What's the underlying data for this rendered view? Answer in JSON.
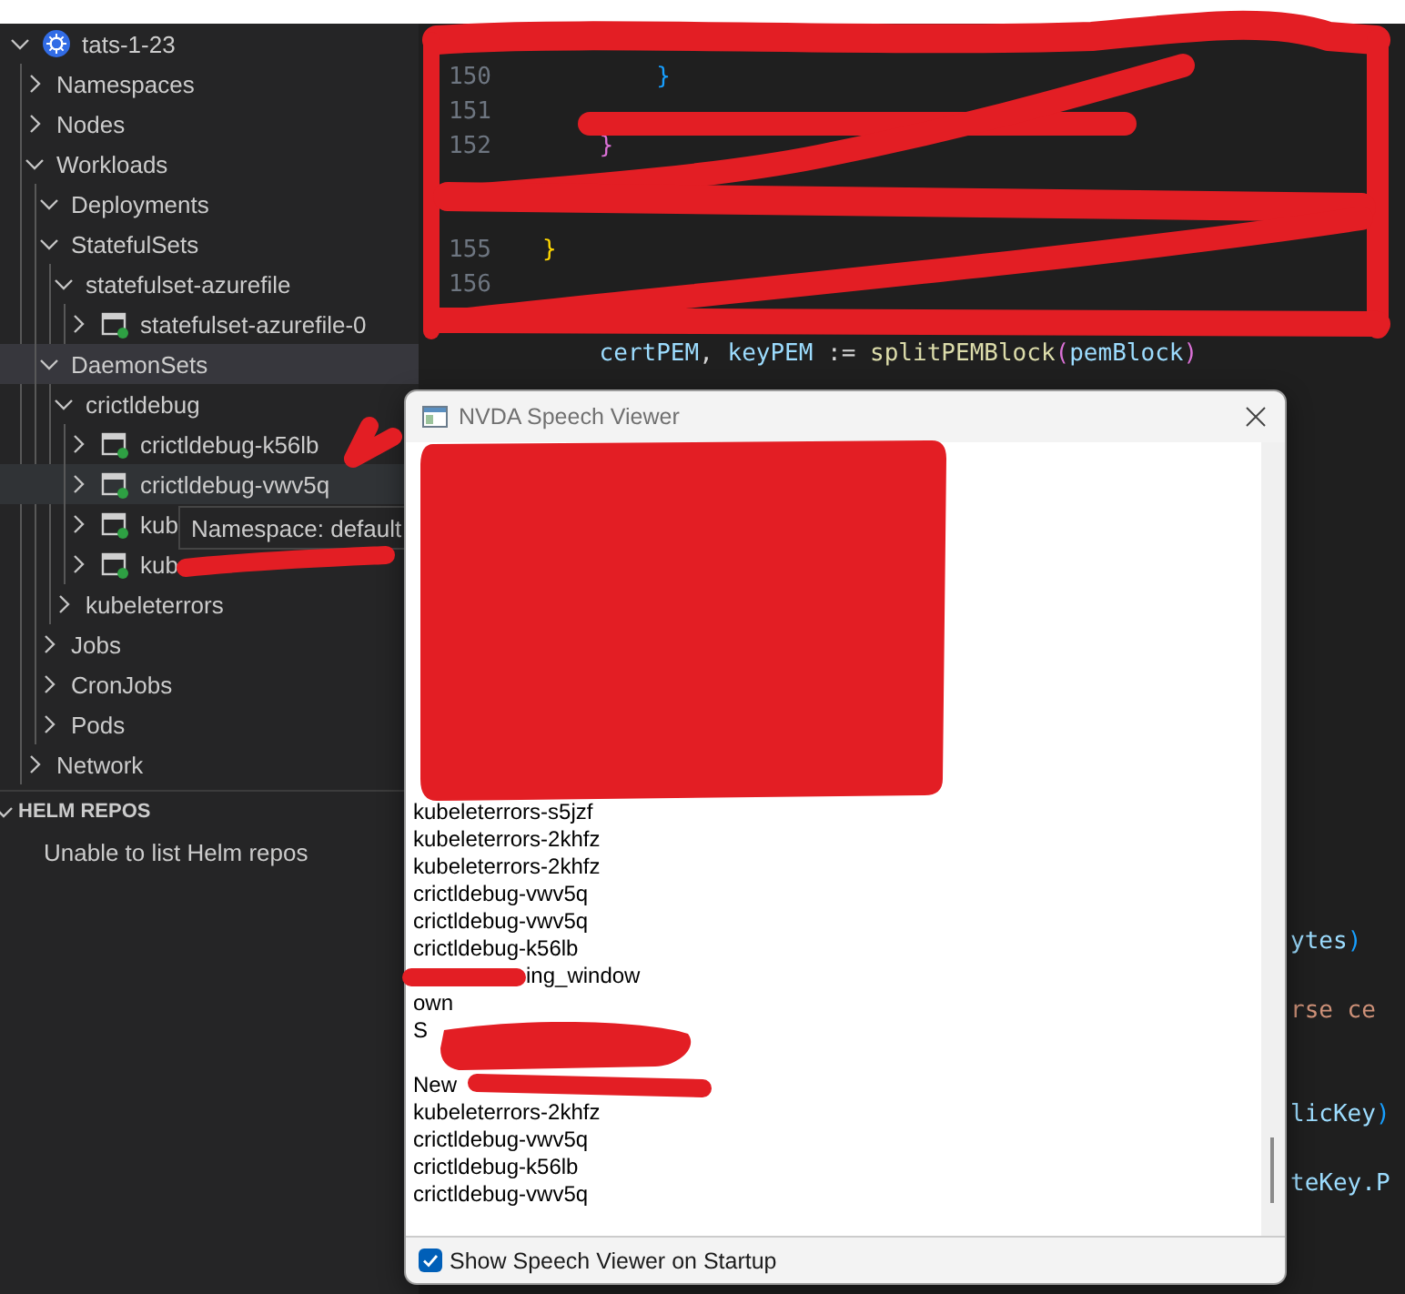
{
  "explorer": {
    "tree": [
      {
        "label": "tats-1-23",
        "kind": "cluster",
        "expanded": true,
        "selected": false,
        "hovered": false,
        "children": [
          {
            "label": "Namespaces",
            "expanded": false,
            "selected": false,
            "hovered": false
          },
          {
            "label": "Nodes",
            "expanded": false,
            "selected": false,
            "hovered": false
          },
          {
            "label": "Workloads",
            "expanded": true,
            "selected": false,
            "hovered": false,
            "children": [
              {
                "label": "Deployments",
                "expanded": true,
                "selected": false,
                "hovered": false
              },
              {
                "label": "StatefulSets",
                "expanded": true,
                "selected": false,
                "hovered": false,
                "children": [
                  {
                    "label": "statefulset-azurefile",
                    "expanded": true,
                    "selected": false,
                    "hovered": false,
                    "children": [
                      {
                        "label": "statefulset-azurefile-0",
                        "kind": "pod",
                        "expanded": false,
                        "selected": false,
                        "hovered": false
                      }
                    ]
                  }
                ]
              },
              {
                "label": "DaemonSets",
                "expanded": true,
                "selected": true,
                "hovered": false,
                "children": [
                  {
                    "label": "crictldebug",
                    "expanded": true,
                    "selected": false,
                    "hovered": false,
                    "children": [
                      {
                        "label": "crictldebug-k56lb",
                        "kind": "pod",
                        "expanded": false,
                        "selected": false,
                        "hovered": false
                      },
                      {
                        "label": "crictldebug-vwv5q",
                        "kind": "pod",
                        "expanded": false,
                        "selected": false,
                        "hovered": true
                      },
                      {
                        "label": "kub",
                        "kind": "pod",
                        "expanded": false,
                        "selected": false,
                        "hovered": false
                      },
                      {
                        "label": "kub",
                        "kind": "pod",
                        "expanded": false,
                        "selected": false,
                        "hovered": false
                      }
                    ]
                  },
                  {
                    "label": "kubeleterrors",
                    "expanded": false,
                    "selected": false,
                    "hovered": false
                  }
                ]
              },
              {
                "label": "Jobs",
                "expanded": false,
                "selected": false,
                "hovered": false
              },
              {
                "label": "CronJobs",
                "expanded": false,
                "selected": false,
                "hovered": false
              },
              {
                "label": "Pods",
                "expanded": false,
                "selected": false,
                "hovered": false
              }
            ]
          },
          {
            "label": "Network",
            "expanded": false,
            "selected": false,
            "hovered": false
          }
        ]
      }
    ],
    "tooltip": {
      "text": "Namespace: default"
    },
    "helm_repos": {
      "title": "HELM REPOS",
      "expanded": true,
      "message": "Unable to list Helm repos"
    }
  },
  "editor": {
    "lines": [
      {
        "number": "150",
        "tokens": [
          {
            "text": "}",
            "color": "#179fff"
          }
        ]
      },
      {
        "number": "151"
      },
      {
        "number": "152",
        "tokens": [
          {
            "text": "}",
            "color": "#da70d6"
          }
        ]
      },
      {
        "number": "155",
        "tokens": [
          {
            "text": "}",
            "color": "#ffd700"
          }
        ]
      },
      {
        "number": "156"
      },
      {
        "tokens": [
          {
            "text": "certPEM",
            "color": "#9cdcfe"
          },
          {
            "text": ", ",
            "color": "#d4d4d4"
          },
          {
            "text": "keyPEM",
            "color": "#9cdcfe"
          },
          {
            "text": " := ",
            "color": "#d4d4d4"
          },
          {
            "text": "splitPEMBlock",
            "color": "#dcdcaa"
          },
          {
            "text": "(",
            "color": "#da70d6"
          },
          {
            "text": "pemBlock",
            "color": "#9cdcfe"
          },
          {
            "text": ")",
            "color": "#da70d6"
          }
        ]
      }
    ],
    "fragments": [
      {
        "tokens": [
          {
            "text": "ytes",
            "color": "#9cdcfe"
          },
          {
            "text": ")",
            "color": "#179fff"
          }
        ]
      },
      {
        "tokens": [
          {
            "text": "rse ce",
            "color": "#ce9178"
          }
        ]
      },
      {
        "tokens": [
          {
            "text": "licKey",
            "color": "#9cdcfe"
          },
          {
            "text": ")",
            "color": "#179fff"
          }
        ]
      },
      {
        "tokens": [
          {
            "text": "teKey.P",
            "color": "#9cdcfe"
          }
        ]
      }
    ]
  },
  "speech_viewer": {
    "title": "NVDA Speech Viewer",
    "lines": [
      {
        "text": "kubeleterrors-s5jzf",
        "kind": "full"
      },
      {
        "text": "kubeleterrors-2khfz",
        "kind": "full"
      },
      {
        "text": "kubeleterrors-2khfz",
        "kind": "full"
      },
      {
        "text": "crictldebug-vwv5q",
        "kind": "full"
      },
      {
        "text": "crictldebug-vwv5q",
        "kind": "full"
      },
      {
        "text": "crictldebug-k56lb",
        "kind": "full"
      },
      {
        "text": "ing_window",
        "kind": "tail"
      },
      {
        "text": "own",
        "kind": "full"
      },
      {
        "text": "S",
        "kind": "full"
      },
      {
        "text": "New",
        "kind": "after_gap"
      },
      {
        "text": "kubeleterrors-2khfz",
        "kind": "full"
      },
      {
        "text": "crictldebug-vwv5q",
        "kind": "full"
      },
      {
        "text": "crictldebug-k56lb",
        "kind": "full"
      },
      {
        "text": "crictldebug-vwv5q",
        "kind": "full"
      }
    ],
    "show_on_startup": {
      "label": "Show Speech Viewer on Startup",
      "checked": true
    }
  }
}
